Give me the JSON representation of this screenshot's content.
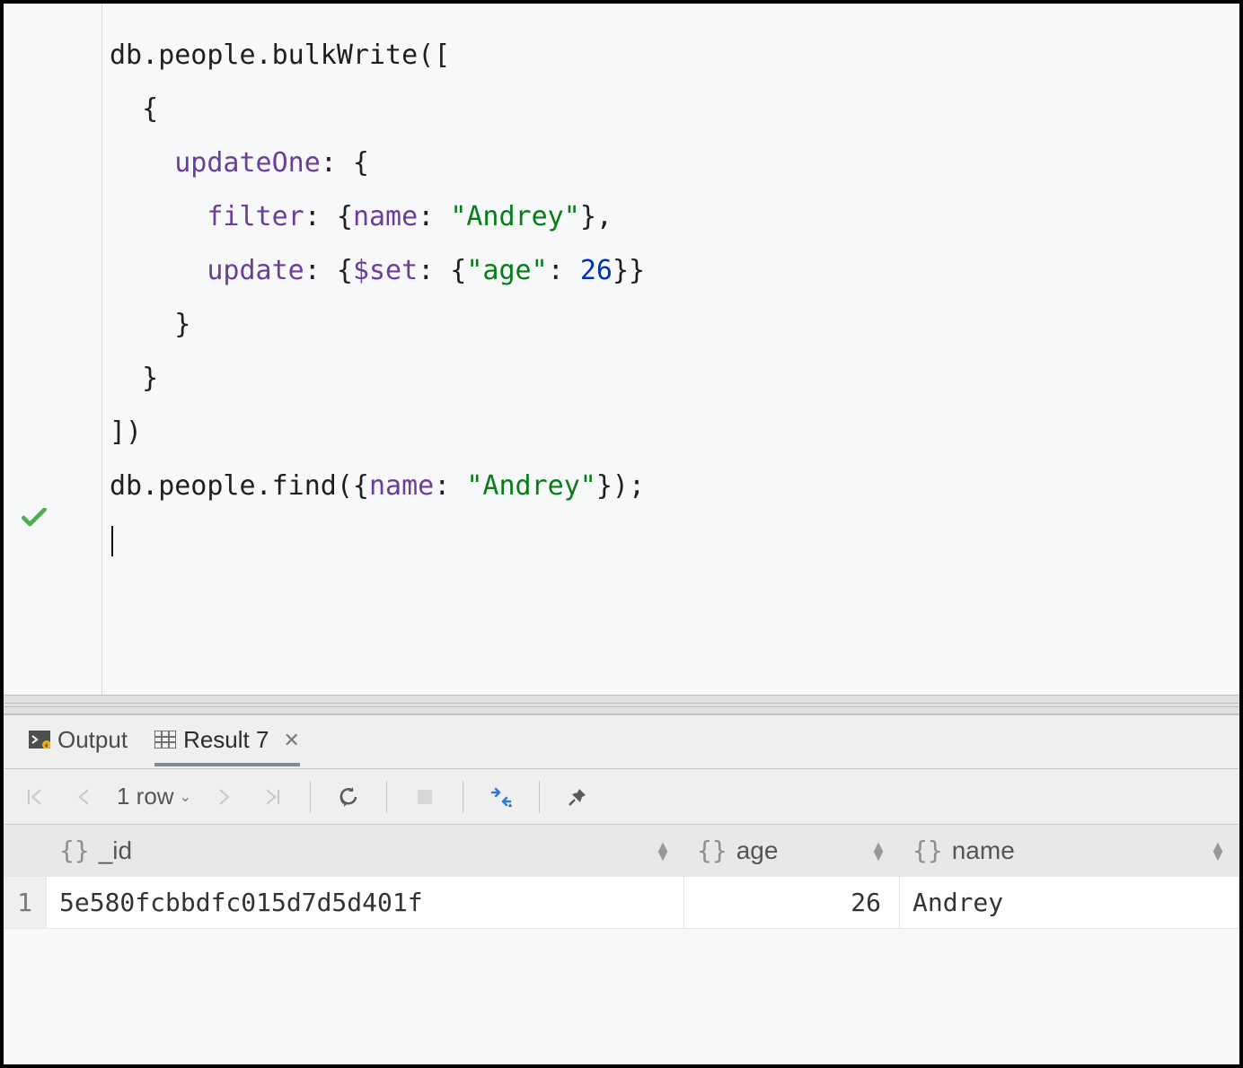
{
  "editor": {
    "lines": [
      {
        "segments": [
          {
            "t": "db",
            "c": "tk-id"
          },
          {
            "t": ".",
            "c": ""
          },
          {
            "t": "people",
            "c": "tk-id"
          },
          {
            "t": ".",
            "c": ""
          },
          {
            "t": "bulkWrite",
            "c": "tk-id"
          },
          {
            "t": "([",
            "c": ""
          }
        ]
      },
      {
        "segments": [
          {
            "t": "  {",
            "c": ""
          }
        ]
      },
      {
        "segments": [
          {
            "t": "    ",
            "c": ""
          },
          {
            "t": "updateOne",
            "c": "tk-prop"
          },
          {
            "t": ": {",
            "c": ""
          }
        ]
      },
      {
        "segments": [
          {
            "t": "      ",
            "c": ""
          },
          {
            "t": "filter",
            "c": "tk-prop"
          },
          {
            "t": ": {",
            "c": ""
          },
          {
            "t": "name",
            "c": "tk-prop"
          },
          {
            "t": ": ",
            "c": ""
          },
          {
            "t": "\"Andrey\"",
            "c": "tk-str"
          },
          {
            "t": "},",
            "c": ""
          }
        ]
      },
      {
        "segments": [
          {
            "t": "      ",
            "c": ""
          },
          {
            "t": "update",
            "c": "tk-prop"
          },
          {
            "t": ": {",
            "c": ""
          },
          {
            "t": "$set",
            "c": "tk-prop"
          },
          {
            "t": ": {",
            "c": ""
          },
          {
            "t": "\"age\"",
            "c": "tk-str"
          },
          {
            "t": ": ",
            "c": ""
          },
          {
            "t": "26",
            "c": "tk-num"
          },
          {
            "t": "}}",
            "c": ""
          }
        ]
      },
      {
        "segments": [
          {
            "t": "    }",
            "c": ""
          }
        ]
      },
      {
        "segments": [
          {
            "t": "  }",
            "c": ""
          }
        ]
      },
      {
        "segments": [
          {
            "t": "])",
            "c": ""
          }
        ]
      },
      {
        "segments": [
          {
            "t": "",
            "c": ""
          }
        ]
      },
      {
        "segments": [
          {
            "t": "db",
            "c": "tk-id"
          },
          {
            "t": ".",
            "c": ""
          },
          {
            "t": "people",
            "c": "tk-id"
          },
          {
            "t": ".",
            "c": ""
          },
          {
            "t": "find",
            "c": "tk-id"
          },
          {
            "t": "({",
            "c": ""
          },
          {
            "t": "name",
            "c": "tk-prop"
          },
          {
            "t": ": ",
            "c": ""
          },
          {
            "t": "\"Andrey\"",
            "c": "tk-str"
          },
          {
            "t": "});",
            "c": ""
          }
        ]
      }
    ]
  },
  "tabs": {
    "output": "Output",
    "result": "Result 7"
  },
  "toolbar": {
    "rows": "1 row"
  },
  "table": {
    "columns": [
      "_id",
      "age",
      "name"
    ],
    "rows": [
      {
        "n": "1",
        "_id": "5e580fcbbdfc015d7d5d401f",
        "age": "26",
        "name": "Andrey"
      }
    ]
  }
}
